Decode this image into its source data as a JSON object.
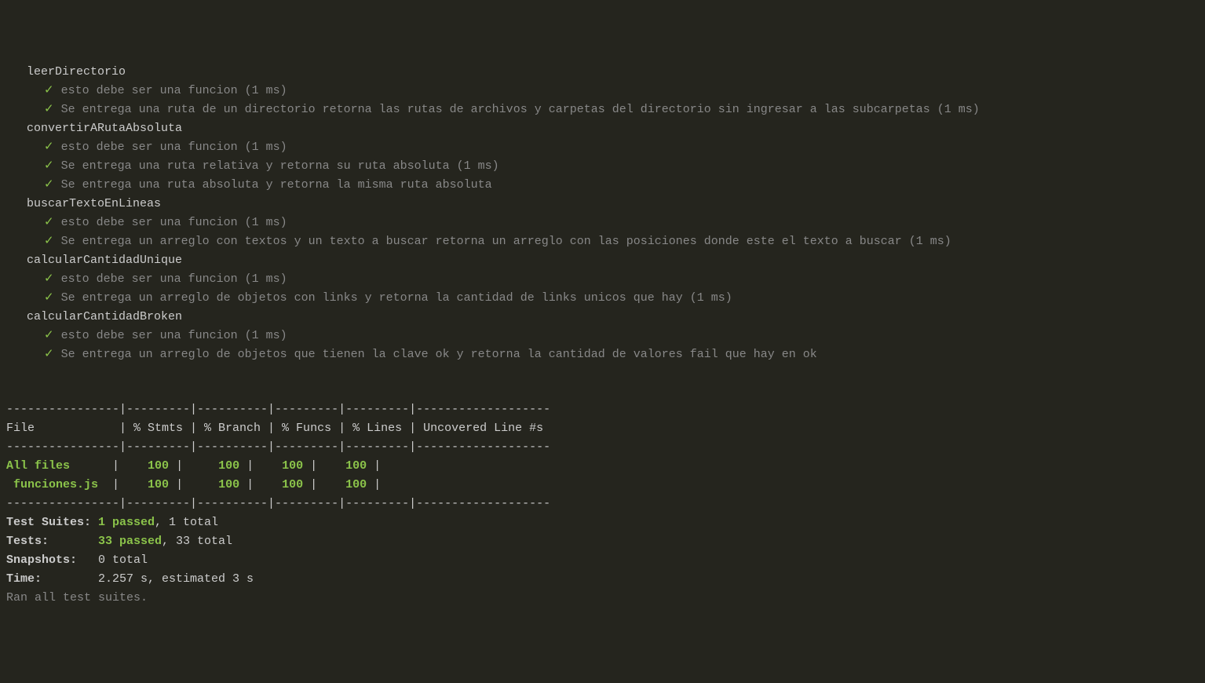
{
  "suites": [
    {
      "name": "leerDirectorio",
      "tests": [
        {
          "desc": "esto debe ser una funcion (1 ms)"
        },
        {
          "desc": "Se entrega una ruta de un directorio retorna las rutas de archivos y carpetas del directorio sin ingresar a las subcarpetas (1 ms)"
        }
      ]
    },
    {
      "name": "convertirARutaAbsoluta",
      "tests": [
        {
          "desc": "esto debe ser una funcion (1 ms)"
        },
        {
          "desc": "Se entrega una ruta relativa y retorna su ruta absoluta (1 ms)"
        },
        {
          "desc": "Se entrega una ruta absoluta y retorna la misma ruta absoluta"
        }
      ]
    },
    {
      "name": "buscarTextoEnLineas",
      "tests": [
        {
          "desc": "esto debe ser una funcion (1 ms)"
        },
        {
          "desc": "Se entrega un arreglo con textos y un texto a buscar retorna un arreglo con las posiciones donde este el texto a buscar (1 ms)"
        }
      ]
    },
    {
      "name": "calcularCantidadUnique",
      "tests": [
        {
          "desc": "esto debe ser una funcion (1 ms)"
        },
        {
          "desc": "Se entrega un arreglo de objetos con links y retorna la cantidad de links unicos que hay (1 ms)"
        }
      ]
    },
    {
      "name": "calcularCantidadBroken",
      "tests": [
        {
          "desc": "esto debe ser una funcion (1 ms)"
        },
        {
          "desc": "Se entrega un arreglo de objetos que tienen la clave ok y retorna la cantidad de valores fail que hay en ok"
        }
      ]
    }
  ],
  "check": "✓",
  "coverage": {
    "sep": "----------------|---------|----------|---------|---------|-------------------",
    "header": "File            | % Stmts | % Branch | % Funcs | % Lines | Uncovered Line #s ",
    "rows": [
      {
        "file": "All files      ",
        "stmts": "    100 ",
        "branch": "     100 ",
        "funcs": "    100 ",
        "lines": "    100 ",
        "uncov": "                   "
      },
      {
        "file": " funciones.js  ",
        "stmts": "    100 ",
        "branch": "     100 ",
        "funcs": "    100 ",
        "lines": "    100 ",
        "uncov": "                   "
      }
    ]
  },
  "summary": {
    "testSuitesLabel": "Test Suites: ",
    "testSuitesPassed": "1 passed",
    "testSuitesRest": ", 1 total",
    "testsLabel": "Tests:       ",
    "testsPassed": "33 passed",
    "testsRest": ", 33 total",
    "snapshotsLabel": "Snapshots:   ",
    "snapshotsValue": "0 total",
    "timeLabel": "Time:        ",
    "timeValue": "2.257 s, estimated 3 s",
    "ranAll": "Ran all test suites."
  }
}
